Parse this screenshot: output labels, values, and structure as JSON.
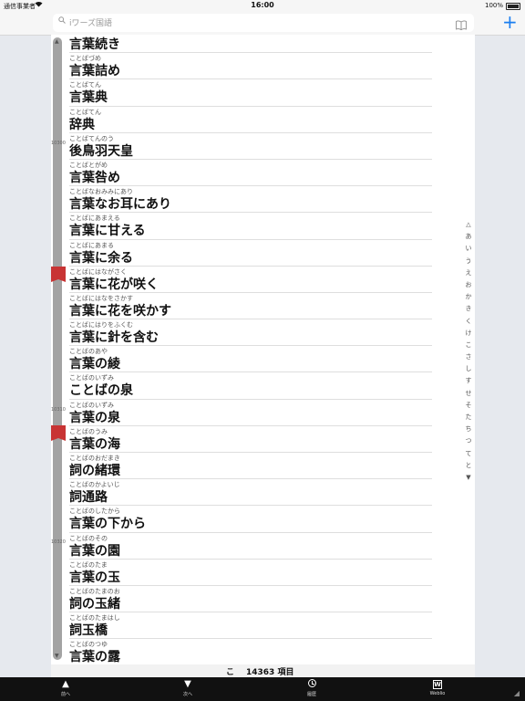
{
  "status_bar": {
    "carrier": "通信事業者",
    "time": "16:00",
    "battery": "100%"
  },
  "search": {
    "placeholder": "iワーズ国語"
  },
  "side_line_numbers": [
    "10300",
    "10310",
    "10320"
  ],
  "entries": [
    {
      "reading": "",
      "word": "言葉続き"
    },
    {
      "reading": "ことばづめ",
      "word": "言葉詰め"
    },
    {
      "reading": "ことばてん",
      "word": "言葉典"
    },
    {
      "reading": "ことばてん",
      "word": "辞典"
    },
    {
      "reading": "ことばてんのう",
      "word": "後鳥羽天皇"
    },
    {
      "reading": "ことばとがめ",
      "word": "言葉咎め"
    },
    {
      "reading": "ことばなおみみにあり",
      "word": "言葉なお耳にあり"
    },
    {
      "reading": "ことばにあまえる",
      "word": "言葉に甘える"
    },
    {
      "reading": "ことばにあまる",
      "word": "言葉に余る"
    },
    {
      "reading": "ことばにはながさく",
      "word": "言葉に花が咲く"
    },
    {
      "reading": "ことばにはなをさかす",
      "word": "言葉に花を咲かす"
    },
    {
      "reading": "ことばにはりをふくむ",
      "word": "言葉に針を含む"
    },
    {
      "reading": "ことばのあや",
      "word": "言葉の綾"
    },
    {
      "reading": "ことばのいずみ",
      "word": "ことばの泉"
    },
    {
      "reading": "ことばのいずみ",
      "word": "言葉の泉"
    },
    {
      "reading": "ことばのうみ",
      "word": "言葉の海"
    },
    {
      "reading": "ことばのおだまき",
      "word": "詞の緒環"
    },
    {
      "reading": "ことばのかよいじ",
      "word": "詞通路"
    },
    {
      "reading": "ことばのしたから",
      "word": "言葉の下から"
    },
    {
      "reading": "ことばのその",
      "word": "言葉の園"
    },
    {
      "reading": "ことばのたま",
      "word": "言葉の玉"
    },
    {
      "reading": "ことばのたまのお",
      "word": "詞の玉緒"
    },
    {
      "reading": "ことばのたまはし",
      "word": "詞玉橋"
    },
    {
      "reading": "ことばのつゆ",
      "word": "言葉の露"
    }
  ],
  "kana_index": [
    "△",
    "あ",
    "い",
    "う",
    "え",
    "お",
    "か",
    "き",
    "く",
    "け",
    "こ",
    "さ",
    "し",
    "す",
    "せ",
    "そ",
    "た",
    "ち",
    "つ",
    "て",
    "と",
    "▼"
  ],
  "footer": {
    "current_kana": "こ",
    "count": "14363 項目"
  },
  "toolbar": {
    "prev_label": "前へ",
    "next_label": "次へ",
    "history_label": "履歴",
    "weblio_label": "Weblio",
    "weblio_glyph": "W",
    "up_glyph": "▲",
    "down_glyph": "▼"
  }
}
